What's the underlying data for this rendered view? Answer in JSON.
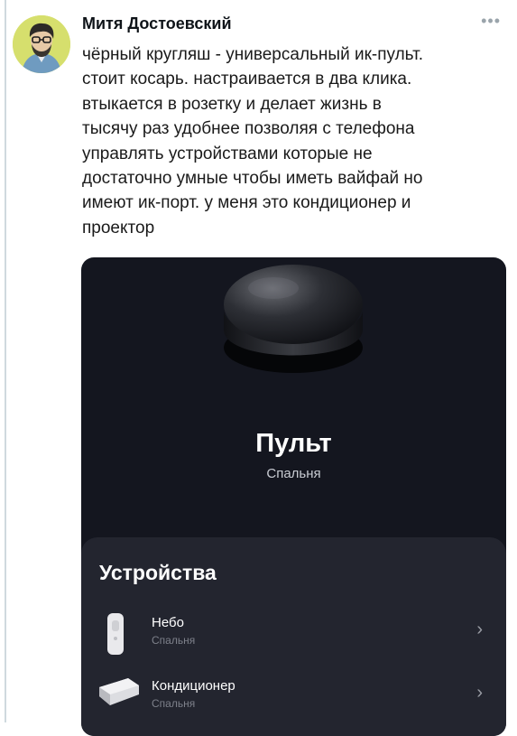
{
  "tweet": {
    "author": "Митя Достоевский",
    "more_icon": "more-icon",
    "lines": [
      "чёрный кругляш - универсальный ик-пульт.",
      "стоит косарь. настраивается в два клика.",
      "втыкается в розетку и делает жизнь в",
      "тысячу раз удобнее позволяя с телефона",
      "управлять устройствами которые не",
      "достаточно умные чтобы иметь вайфай но",
      "имеют ик-порт. у меня это кондиционер и",
      "проектор"
    ]
  },
  "card": {
    "title": "Пульт",
    "subtitle": "Спальня",
    "devices_heading": "Устройства",
    "devices": [
      {
        "name": "Небо",
        "room": "Спальня",
        "icon": "remote-icon"
      },
      {
        "name": "Кондиционер",
        "room": "Спальня",
        "icon": "air-conditioner-icon"
      }
    ]
  }
}
